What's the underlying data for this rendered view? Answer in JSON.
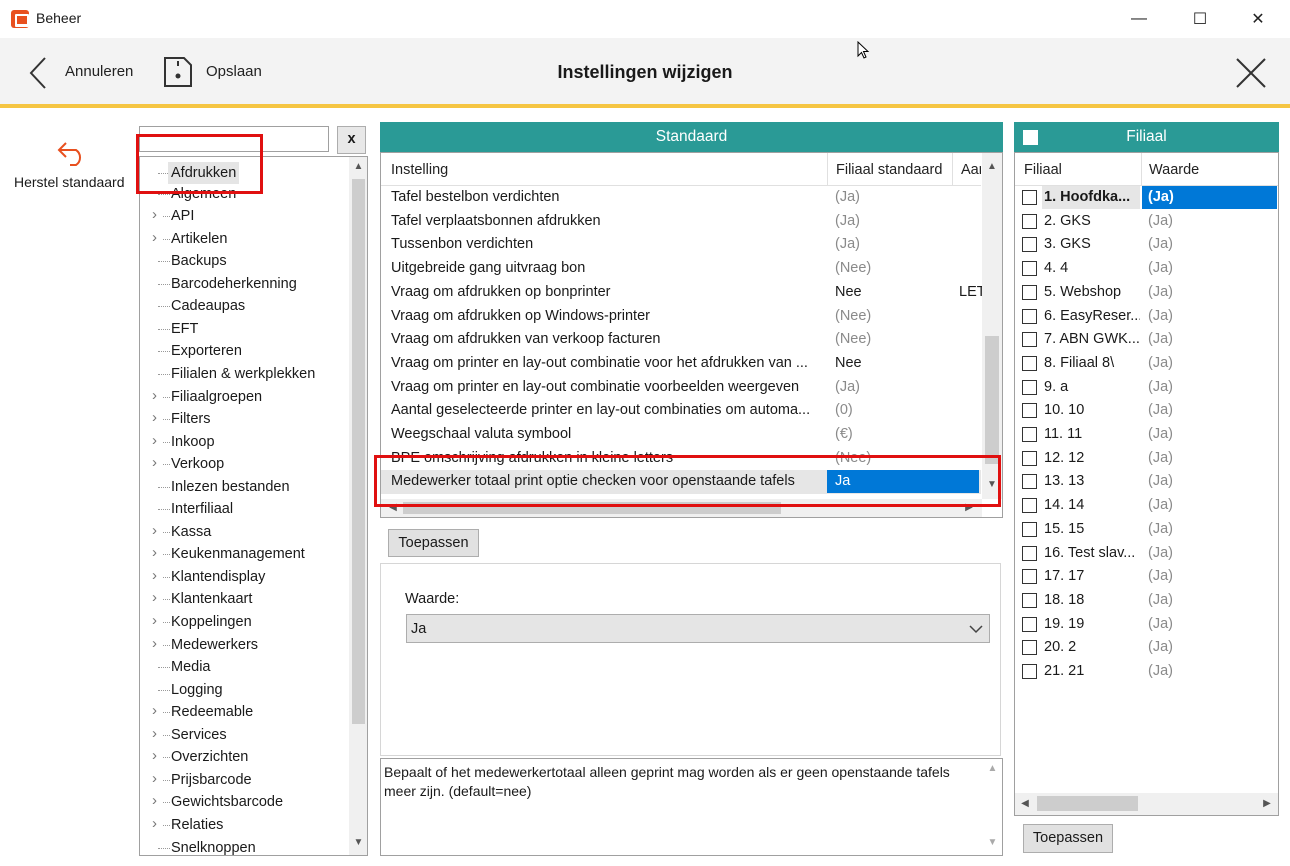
{
  "window": {
    "title": "Beheer",
    "minimize": "—",
    "maximize": "☐",
    "close": "✕"
  },
  "toolbar": {
    "cancel_label": "Annuleren",
    "save_label": "Opslaan",
    "title": "Instellingen wijzigen"
  },
  "left": {
    "reset_label": "Herstel standaard",
    "search_value": "",
    "clear_label": "x",
    "tree": [
      {
        "label": "Afdrukken",
        "expand": false
      },
      {
        "label": "Algemeen",
        "expand": false
      },
      {
        "label": "API",
        "expand": true
      },
      {
        "label": "Artikelen",
        "expand": true
      },
      {
        "label": "Backups",
        "expand": false
      },
      {
        "label": "Barcodeherkenning",
        "expand": false
      },
      {
        "label": "Cadeaupas",
        "expand": false
      },
      {
        "label": "EFT",
        "expand": false
      },
      {
        "label": "Exporteren",
        "expand": false
      },
      {
        "label": "Filialen & werkplekken",
        "expand": false
      },
      {
        "label": "Filiaalgroepen",
        "expand": true
      },
      {
        "label": "Filters",
        "expand": true
      },
      {
        "label": "Inkoop",
        "expand": true
      },
      {
        "label": "Verkoop",
        "expand": true
      },
      {
        "label": "Inlezen bestanden",
        "expand": false
      },
      {
        "label": "Interfiliaal",
        "expand": false
      },
      {
        "label": "Kassa",
        "expand": true
      },
      {
        "label": "Keukenmanagement",
        "expand": true
      },
      {
        "label": "Klantendisplay",
        "expand": true
      },
      {
        "label": "Klantenkaart",
        "expand": true
      },
      {
        "label": "Koppelingen",
        "expand": true
      },
      {
        "label": "Medewerkers",
        "expand": true
      },
      {
        "label": "Media",
        "expand": false
      },
      {
        "label": "Logging",
        "expand": false
      },
      {
        "label": "Redeemable",
        "expand": true
      },
      {
        "label": "Services",
        "expand": true
      },
      {
        "label": "Overzichten",
        "expand": true
      },
      {
        "label": "Prijsbarcode",
        "expand": true
      },
      {
        "label": "Gewichtsbarcode",
        "expand": true
      },
      {
        "label": "Relaties",
        "expand": true
      },
      {
        "label": "Snelknoppen",
        "expand": false
      }
    ]
  },
  "standaard": {
    "header": "Standaard",
    "columns": [
      "Instelling",
      "Filiaal standaard",
      "Aan"
    ],
    "rows": [
      {
        "name": "Tafel bestelbon verdichten",
        "value": "(Ja)",
        "extra": "",
        "gray": true
      },
      {
        "name": "Tafel verplaatsbonnen afdrukken",
        "value": "(Ja)",
        "extra": "",
        "gray": true
      },
      {
        "name": "Tussenbon verdichten",
        "value": "(Ja)",
        "extra": "",
        "gray": true
      },
      {
        "name": "Uitgebreide gang uitvraag bon",
        "value": "(Nee)",
        "extra": "",
        "gray": true
      },
      {
        "name": "Vraag om afdrukken op bonprinter",
        "value": "Nee",
        "extra": "LET",
        "gray": false
      },
      {
        "name": "Vraag om afdrukken op Windows-printer",
        "value": "(Nee)",
        "extra": "",
        "gray": true
      },
      {
        "name": "Vraag om afdrukken van verkoop facturen",
        "value": "(Nee)",
        "extra": "",
        "gray": true
      },
      {
        "name": "Vraag om printer en lay-out combinatie voor het afdrukken van ...",
        "value": "Nee",
        "extra": "",
        "gray": false
      },
      {
        "name": "Vraag om printer en lay-out combinatie voorbeelden weergeven",
        "value": "(Ja)",
        "extra": "",
        "gray": true
      },
      {
        "name": "Aantal geselecteerde printer en lay-out combinaties om automa...",
        "value": "(0)",
        "extra": "",
        "gray": true
      },
      {
        "name": "Weegschaal valuta symbool",
        "value": "(€)",
        "extra": "",
        "gray": true
      },
      {
        "name": "BPE omschrijving afdrukken in kleine letters",
        "value": "(Nee)",
        "extra": "",
        "gray": true
      },
      {
        "name": "Medewerker totaal print optie checken voor openstaande tafels",
        "value": "Ja",
        "extra": "",
        "gray": false,
        "selected": true
      }
    ],
    "apply_label": "Toepassen",
    "waarde_label": "Waarde:",
    "waarde_value": "Ja",
    "description": "Bepaalt of het medewerkertotaal alleen geprint mag worden als er geen openstaande tafels meer zijn. (default=nee)"
  },
  "filiaal": {
    "header": "Filiaal",
    "columns": [
      "Filiaal",
      "Waarde"
    ],
    "rows": [
      {
        "name": "1. Hoofdka...",
        "value": "(Ja)",
        "selected": true
      },
      {
        "name": "2. GKS",
        "value": "(Ja)"
      },
      {
        "name": "3. GKS",
        "value": "(Ja)"
      },
      {
        "name": "4. 4",
        "value": "(Ja)"
      },
      {
        "name": "5. Webshop",
        "value": "(Ja)"
      },
      {
        "name": "6. EasyReser...",
        "value": "(Ja)"
      },
      {
        "name": "7. ABN GWK...",
        "value": "(Ja)"
      },
      {
        "name": "8. Filiaal 8\\",
        "value": "(Ja)"
      },
      {
        "name": "9. a",
        "value": "(Ja)"
      },
      {
        "name": "10. 10",
        "value": "(Ja)"
      },
      {
        "name": "11. 11",
        "value": "(Ja)"
      },
      {
        "name": "12. 12",
        "value": "(Ja)"
      },
      {
        "name": "13. 13",
        "value": "(Ja)"
      },
      {
        "name": "14. 14",
        "value": "(Ja)"
      },
      {
        "name": "15. 15",
        "value": "(Ja)"
      },
      {
        "name": "16. Test slav...",
        "value": "(Ja)"
      },
      {
        "name": "17. 17",
        "value": "(Ja)"
      },
      {
        "name": "18. 18",
        "value": "(Ja)"
      },
      {
        "name": "19. 19",
        "value": "(Ja)"
      },
      {
        "name": "20. 2",
        "value": "(Ja)"
      },
      {
        "name": "21. 21",
        "value": "(Ja)"
      }
    ],
    "apply_label": "Toepassen"
  },
  "colors": {
    "accent": "#2a9a96",
    "toolbar_accent": "#f5c542",
    "selection": "#0078d7",
    "highlight_box": "#e01010",
    "reset_icon": "#e8501f"
  },
  "icons": {
    "back": "chevron-left-icon",
    "save": "save-icon",
    "close": "close-x-icon",
    "reset": "undo-arrow-icon"
  }
}
